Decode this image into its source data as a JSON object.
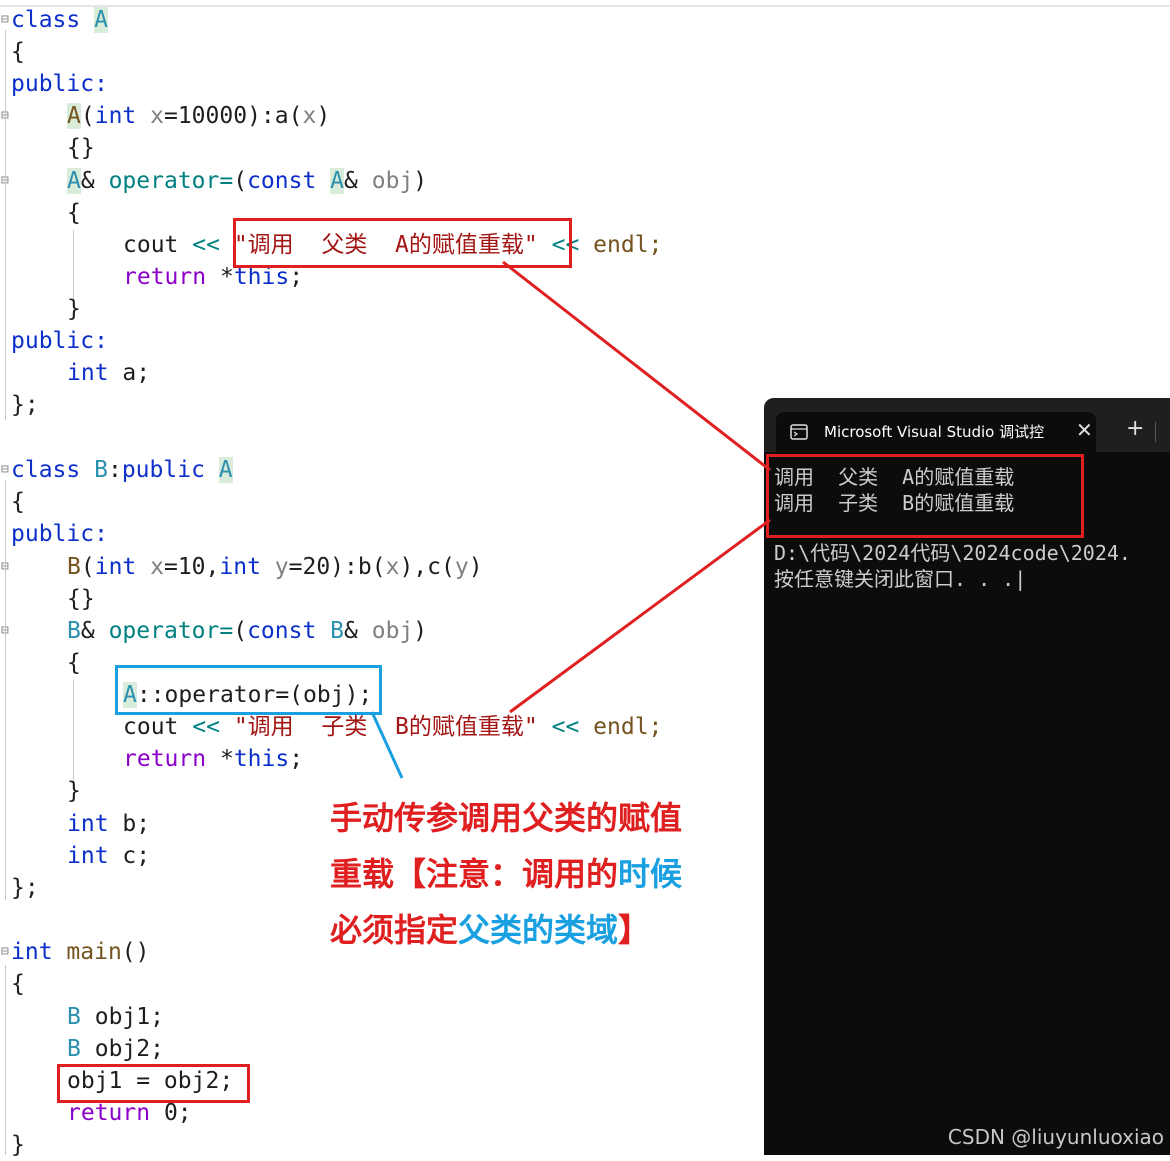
{
  "code": {
    "l1": {
      "kw": "class",
      "name": "A"
    },
    "l2": "{",
    "l3": "public:",
    "l4": {
      "ctor": "A",
      "open": "(",
      "type": "int",
      "param": "x",
      "rest": "=10000):a(",
      "arg": "x",
      "close": ")"
    },
    "l5": "{}",
    "l6": {
      "ret": "A",
      "amp": "&",
      "fn": "operator=",
      "open": "(",
      "const": "const",
      "ptype": "A",
      "amp2": "&",
      "param": "obj",
      "close": ")"
    },
    "l7": "{",
    "l8": {
      "cout": "cout",
      "op": "<<",
      "str": "\"调用  父类  A的赋值重载\"",
      "op2": "<<",
      "endl": "endl;"
    },
    "l9": {
      "ret": "return",
      "star": "*",
      "this": "this",
      ";": ";"
    },
    "l10": "}",
    "l11": "public:",
    "l12": {
      "type": "int",
      "rest": "a;"
    },
    "l13": "};",
    "l14": {
      "kw": "class",
      "name": "B",
      "colon": ":",
      "pub": "public",
      "base": "A"
    },
    "l15": "{",
    "l16": "public:",
    "l17": {
      "ctor": "B",
      "open": "(",
      "type": "int",
      "p1": "x",
      "mid": "=10,",
      "type2": "int",
      "p2": "y",
      "mid2": "=20):b(",
      "a1": "x",
      "mid3": "),c(",
      "a2": "y",
      "close": ")"
    },
    "l18": "{}",
    "l19": {
      "ret": "B",
      "amp": "&",
      "fn": "operator=",
      "open": "(",
      "const": "const",
      "ptype": "B",
      "amp2": "&",
      "param": "obj",
      "close": ")"
    },
    "l20": "{",
    "l21": {
      "scope": "A",
      "rest": "::operator=(obj);"
    },
    "l22": {
      "cout": "cout",
      "op": "<<",
      "str": "\"调用  子类  B的赋值重载\"",
      "op2": "<<",
      "endl": "endl;"
    },
    "l23": {
      "ret": "return",
      "star": "*",
      "this": "this",
      ";": ";"
    },
    "l24": "}",
    "l25": {
      "type": "int",
      "rest": "b;"
    },
    "l26": {
      "type": "int",
      "rest": "c;"
    },
    "l27": "};",
    "l28": {
      "type": "int",
      "fn": "main",
      "rest": "()"
    },
    "l29": "{",
    "l30": {
      "type": "B",
      "rest": "obj1;"
    },
    "l31": {
      "type": "B",
      "rest": "obj2;"
    },
    "l32": "obj1 = obj2;",
    "l33": {
      "ret": "return",
      "rest": "0;"
    },
    "l34": "}"
  },
  "annotation": {
    "part1": "手动传参调用父类的赋值重载【注意：调用的",
    "part2": "时候",
    "part3": "必须指定",
    "part4": "父类的类域",
    "part5": "】"
  },
  "console": {
    "tab_title": "Microsoft Visual Studio 调试控",
    "tab_icon": "terminal-icon",
    "new_tab": "+",
    "close": "✕",
    "out1": "调用  父类  A的赋值重载",
    "out2": "调用  子类  B的赋值重载",
    "path": "D:\\代码\\2024代码\\2024code\\2024.",
    "prompt": "按任意键关闭此窗口. . .|"
  },
  "watermark": "CSDN @liuyunluoxiao",
  "colors": {
    "red": "#e02020",
    "blue": "#1aa0e0",
    "keyword": "#0c30c9",
    "type": "#2b91af"
  }
}
